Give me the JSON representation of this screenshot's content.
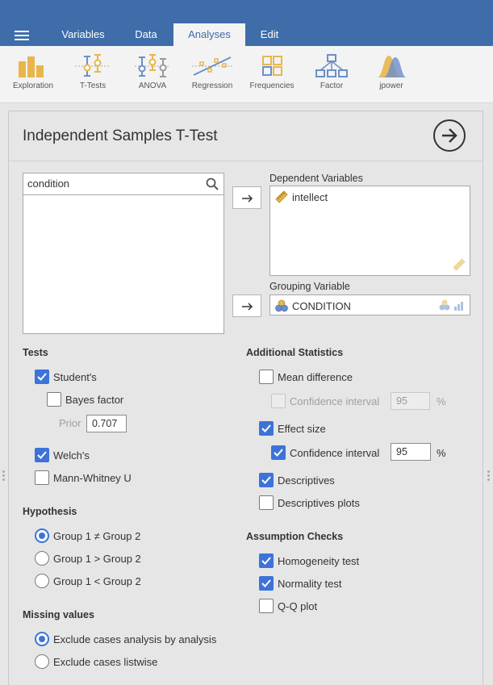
{
  "nav": {
    "tabs": [
      {
        "label": "Variables"
      },
      {
        "label": "Data"
      },
      {
        "label": "Analyses"
      },
      {
        "label": "Edit"
      }
    ]
  },
  "ribbon": {
    "buttons": [
      {
        "label": "Exploration",
        "icon": "exploration-icon"
      },
      {
        "label": "T-Tests",
        "icon": "t-tests-icon"
      },
      {
        "label": "ANOVA",
        "icon": "anova-icon"
      },
      {
        "label": "Regression",
        "icon": "regression-icon"
      },
      {
        "label": "Frequencies",
        "icon": "frequencies-icon"
      },
      {
        "label": "Factor",
        "icon": "factor-icon"
      },
      {
        "label": "jpower",
        "icon": "jpower-icon"
      }
    ]
  },
  "analysis": {
    "title": "Independent Samples T-Test",
    "search_value": "condition",
    "dependent_label": "Dependent Variables",
    "dependent_items": [
      "intellect"
    ],
    "grouping_label": "Grouping Variable",
    "grouping_value": "CONDITION"
  },
  "tests": {
    "heading": "Tests",
    "students": "Student's",
    "bayes": "Bayes factor",
    "prior_label": "Prior",
    "prior_value": "0.707",
    "welchs": "Welch's",
    "mann_whitney": "Mann-Whitney U"
  },
  "hypothesis": {
    "heading": "Hypothesis",
    "options": [
      "Group 1 ≠ Group 2",
      "Group 1 > Group 2",
      "Group 1 < Group 2"
    ]
  },
  "missing": {
    "heading": "Missing values",
    "options": [
      "Exclude cases analysis by analysis",
      "Exclude cases listwise"
    ]
  },
  "additional": {
    "heading": "Additional Statistics",
    "mean_difference": "Mean difference",
    "ci_label": "Confidence interval",
    "ci_md_value": "95",
    "effect_size": "Effect size",
    "ci_es_value": "95",
    "percent": "%",
    "descriptives": "Descriptives",
    "descriptives_plots": "Descriptives plots"
  },
  "assumptions": {
    "heading": "Assumption Checks",
    "homogeneity": "Homogeneity test",
    "normality": "Normality test",
    "qq_plot": "Q-Q plot"
  },
  "colors": {
    "brand_blue": "#3e6da9",
    "check_blue": "#3d73d8",
    "ribbon_orange": "#e8b64c",
    "ribbon_blue": "#6b8fc9"
  }
}
